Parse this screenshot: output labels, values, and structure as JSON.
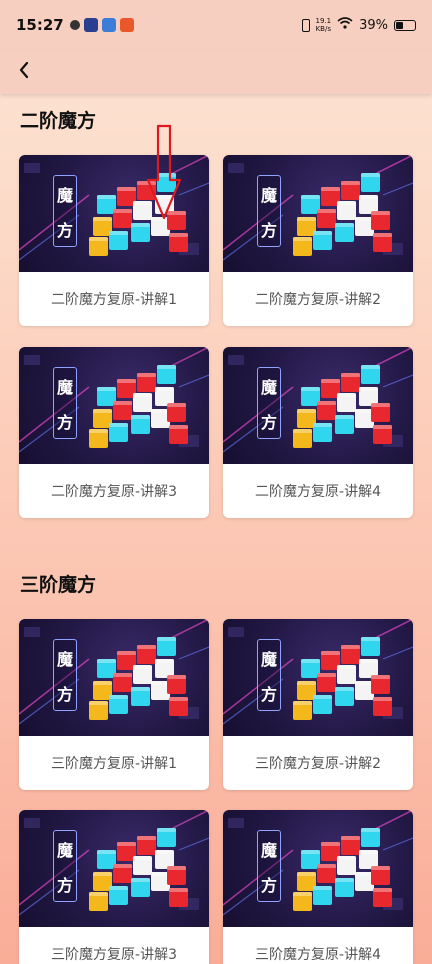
{
  "status_bar": {
    "time": "15:27",
    "net_speed_value": "19.1",
    "net_speed_unit": "KB/s",
    "battery": "39%",
    "battery_level": 0.39
  },
  "nav": {
    "back_icon": "chevron-left-icon"
  },
  "sections": [
    {
      "title": "二阶魔方",
      "cards": [
        {
          "label": "二阶魔方复原-讲解1",
          "tag_top": "魔",
          "tag_bottom": "方"
        },
        {
          "label": "二阶魔方复原-讲解2",
          "tag_top": "魔",
          "tag_bottom": "方"
        },
        {
          "label": "二阶魔方复原-讲解3",
          "tag_top": "魔",
          "tag_bottom": "方"
        },
        {
          "label": "二阶魔方复原-讲解4",
          "tag_top": "魔",
          "tag_bottom": "方"
        }
      ]
    },
    {
      "title": "三阶魔方",
      "cards": [
        {
          "label": "三阶魔方复原-讲解1",
          "tag_top": "魔",
          "tag_bottom": "方"
        },
        {
          "label": "三阶魔方复原-讲解2",
          "tag_top": "魔",
          "tag_bottom": "方"
        },
        {
          "label": "三阶魔方复原-讲解3",
          "tag_top": "魔",
          "tag_bottom": "方"
        },
        {
          "label": "三阶魔方复原-讲解4",
          "tag_top": "魔",
          "tag_bottom": "方"
        }
      ]
    }
  ],
  "colors": {
    "cube_red": "#e8282e",
    "cube_cyan": "#2fd6ee",
    "cube_yellow": "#f5b81c",
    "cube_white": "#f4f4f4",
    "annotation_arrow": "#e0191f"
  }
}
